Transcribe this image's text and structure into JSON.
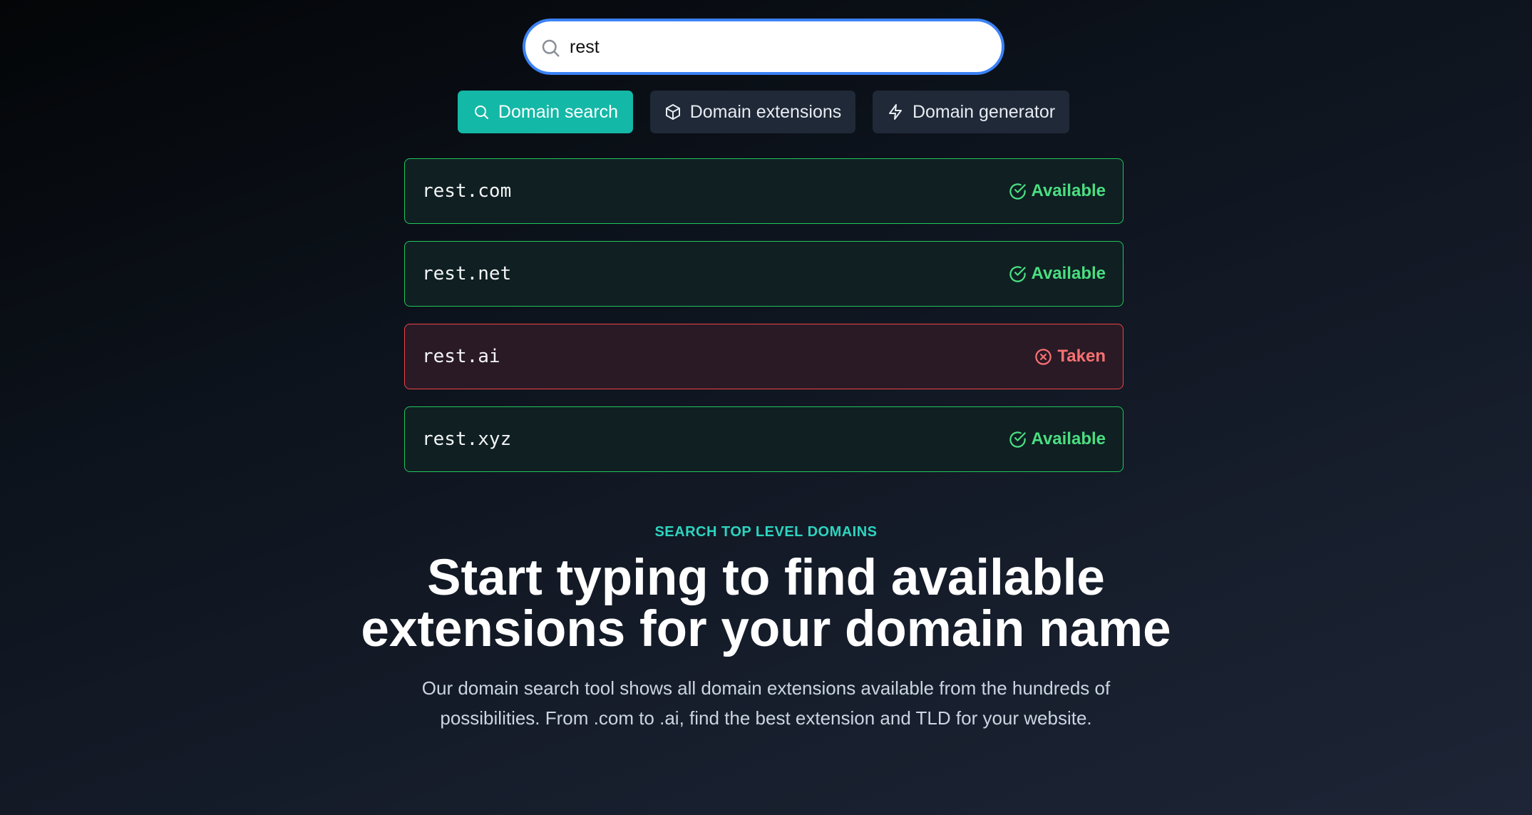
{
  "search": {
    "value": "rest",
    "icon": "search-icon"
  },
  "tabs": [
    {
      "label": "Domain search",
      "icon": "search-icon",
      "active": true
    },
    {
      "label": "Domain extensions",
      "icon": "cube-icon",
      "active": false
    },
    {
      "label": "Domain generator",
      "icon": "lightning-icon",
      "active": false
    }
  ],
  "results": [
    {
      "domain": "rest.com",
      "status": "Available",
      "icon": "check-circle-icon"
    },
    {
      "domain": "rest.net",
      "status": "Available",
      "icon": "check-circle-icon"
    },
    {
      "domain": "rest.ai",
      "status": "Taken",
      "icon": "x-circle-icon"
    },
    {
      "domain": "rest.xyz",
      "status": "Available",
      "icon": "check-circle-icon"
    }
  ],
  "hero": {
    "eyebrow": "SEARCH TOP LEVEL DOMAINS",
    "headline_line1": "Start typing to find available",
    "headline_line2": "extensions for your domain name",
    "description_line1": "Our domain search tool shows all domain extensions available from the hundreds of",
    "description_line2": "possibilities. From .com to .ai, find the best extension and TLD for your website."
  },
  "colors": {
    "accent": "#14b8a6",
    "available": "#22c55e",
    "taken": "#ef4444",
    "focus_ring": "#3b82f6"
  }
}
